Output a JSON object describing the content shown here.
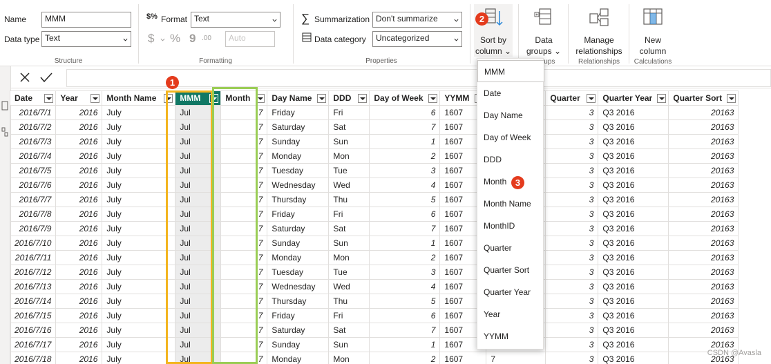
{
  "ribbon": {
    "structure": {
      "name_label": "Name",
      "name_value": "MMM",
      "datatype_label": "Data type",
      "datatype_value": "Text",
      "group_label": "Structure"
    },
    "formatting": {
      "format_label": "Format",
      "format_value": "Text",
      "currency_symbol": "$",
      "percent_symbol": "%",
      "comma_symbol": "9",
      "decimals_symbol": ".00",
      "auto_value": "Auto",
      "group_label": "Formatting"
    },
    "properties": {
      "summarization_label": "Summarization",
      "summarization_value": "Don't summarize",
      "category_label": "Data category",
      "category_value": "Uncategorized",
      "group_label": "Properties"
    },
    "sort_by_column": {
      "line1": "Sort by",
      "line2": "column"
    },
    "data_groups": {
      "line1": "Data",
      "line2": "groups",
      "group_label": "Groups"
    },
    "relationships": {
      "line1": "Manage",
      "line2": "relationships",
      "group_label": "Relationships"
    },
    "calculations": {
      "line1": "New",
      "line2": "column",
      "group_label": "Calculations"
    }
  },
  "badges": {
    "b1": "1",
    "b2": "2",
    "b3": "3"
  },
  "table": {
    "columns": [
      "Date",
      "Year",
      "Month Name",
      "MMM",
      "Month",
      "Day Name",
      "DDD",
      "Day of Week",
      "YYMM",
      "",
      "Quarter",
      "Quarter Year",
      "Quarter Sort"
    ],
    "rows": [
      [
        "2016/7/1",
        "2016",
        "July",
        "Jul",
        "7",
        "Friday",
        "Fri",
        "6",
        "1607",
        "",
        "3",
        "Q3 2016",
        "20163"
      ],
      [
        "2016/7/2",
        "2016",
        "July",
        "Jul",
        "7",
        "Saturday",
        "Sat",
        "7",
        "1607",
        "",
        "3",
        "Q3 2016",
        "20163"
      ],
      [
        "2016/7/3",
        "2016",
        "July",
        "Jul",
        "7",
        "Sunday",
        "Sun",
        "1",
        "1607",
        "",
        "3",
        "Q3 2016",
        "20163"
      ],
      [
        "2016/7/4",
        "2016",
        "July",
        "Jul",
        "7",
        "Monday",
        "Mon",
        "2",
        "1607",
        "",
        "3",
        "Q3 2016",
        "20163"
      ],
      [
        "2016/7/5",
        "2016",
        "July",
        "Jul",
        "7",
        "Tuesday",
        "Tue",
        "3",
        "1607",
        "",
        "3",
        "Q3 2016",
        "20163"
      ],
      [
        "2016/7/6",
        "2016",
        "July",
        "Jul",
        "7",
        "Wednesday",
        "Wed",
        "4",
        "1607",
        "",
        "3",
        "Q3 2016",
        "20163"
      ],
      [
        "2016/7/7",
        "2016",
        "July",
        "Jul",
        "7",
        "Thursday",
        "Thu",
        "5",
        "1607",
        "",
        "3",
        "Q3 2016",
        "20163"
      ],
      [
        "2016/7/8",
        "2016",
        "July",
        "Jul",
        "7",
        "Friday",
        "Fri",
        "6",
        "1607",
        "",
        "3",
        "Q3 2016",
        "20163"
      ],
      [
        "2016/7/9",
        "2016",
        "July",
        "Jul",
        "7",
        "Saturday",
        "Sat",
        "7",
        "1607",
        "",
        "3",
        "Q3 2016",
        "20163"
      ],
      [
        "2016/7/10",
        "2016",
        "July",
        "Jul",
        "7",
        "Sunday",
        "Sun",
        "1",
        "1607",
        "",
        "3",
        "Q3 2016",
        "20163"
      ],
      [
        "2016/7/11",
        "2016",
        "July",
        "Jul",
        "7",
        "Monday",
        "Mon",
        "2",
        "1607",
        "",
        "3",
        "Q3 2016",
        "20163"
      ],
      [
        "2016/7/12",
        "2016",
        "July",
        "Jul",
        "7",
        "Tuesday",
        "Tue",
        "3",
        "1607",
        "",
        "3",
        "Q3 2016",
        "20163"
      ],
      [
        "2016/7/13",
        "2016",
        "July",
        "Jul",
        "7",
        "Wednesday",
        "Wed",
        "4",
        "1607",
        "",
        "3",
        "Q3 2016",
        "20163"
      ],
      [
        "2016/7/14",
        "2016",
        "July",
        "Jul",
        "7",
        "Thursday",
        "Thu",
        "5",
        "1607",
        "",
        "3",
        "Q3 2016",
        "20163"
      ],
      [
        "2016/7/15",
        "2016",
        "July",
        "Jul",
        "7",
        "Friday",
        "Fri",
        "6",
        "1607",
        "",
        "3",
        "Q3 2016",
        "20163"
      ],
      [
        "2016/7/16",
        "2016",
        "July",
        "Jul",
        "7",
        "Saturday",
        "Sat",
        "7",
        "1607",
        "",
        "3",
        "Q3 2016",
        "20163"
      ],
      [
        "2016/7/17",
        "2016",
        "July",
        "Jul",
        "7",
        "Sunday",
        "Sun",
        "1",
        "1607",
        "",
        "3",
        "Q3 2016",
        "20163"
      ],
      [
        "2016/7/18",
        "2016",
        "July",
        "Jul",
        "7",
        "Monday",
        "Mon",
        "2",
        "1607",
        "7",
        "3",
        "Q3 2016",
        "20163"
      ]
    ]
  },
  "sort_menu": {
    "items": [
      "MMM",
      "Date",
      "Day Name",
      "Day of Week",
      "DDD",
      "Month",
      "Month Name",
      "MonthID",
      "Quarter",
      "Quarter Sort",
      "Quarter Year",
      "Year",
      "YYMM"
    ]
  },
  "watermark": "CSDN @Avasla",
  "colors": {
    "selected_header": "#117865",
    "highlight_mmm": "#f3b51f",
    "highlight_month": "#9acd55",
    "badge": "#e43b1d"
  }
}
